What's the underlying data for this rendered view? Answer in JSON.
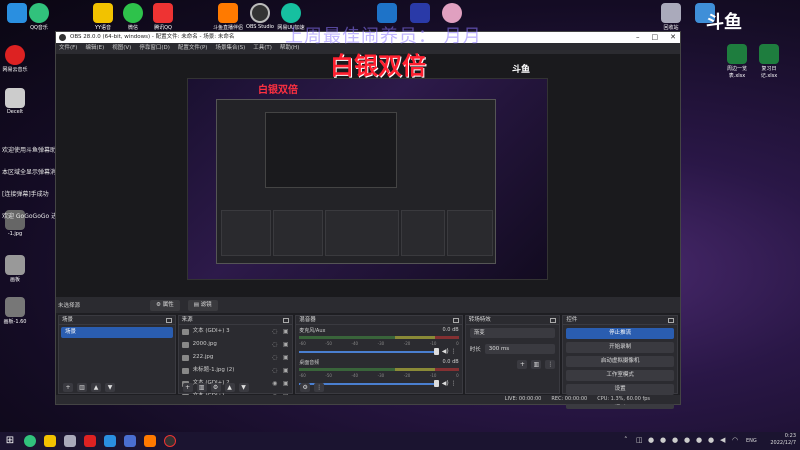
{
  "desktop": {
    "icons_top": [
      {
        "label": "QQ",
        "color": "#2a8fe0"
      },
      {
        "label": "QQ音乐",
        "color": "#31c27c"
      },
      {
        "label": "YY语音",
        "color": "#f2c200"
      },
      {
        "label": "微信",
        "color": "#2ec24b"
      },
      {
        "label": "腾讯QQ",
        "color": "#e33"
      },
      {
        "label": "斗鱼直播伴侣",
        "color": "#ff7a00"
      },
      {
        "label": "OBS Studio",
        "color": "#333"
      },
      {
        "label": "网易UU加速器",
        "color": "#16c0a0"
      },
      {
        "label": "",
        "color": "#1e73c8"
      },
      {
        "label": "",
        "color": "#2a3aa8"
      },
      {
        "label": "",
        "color": "#e0a0c0"
      },
      {
        "label": "回收站",
        "color": "#aab"
      },
      {
        "label": "",
        "color": "#3f8fd8"
      }
    ],
    "icons_left": [
      {
        "label": "网易云音乐",
        "color": "#d22"
      },
      {
        "label": "Decelt",
        "color": "#ccc"
      },
      {
        "label": "",
        "color": "#4a4"
      },
      {
        "label": "-1.jpg",
        "color": "#666"
      },
      {
        "label": "画板",
        "color": "#999"
      },
      {
        "label": "画板-1.60",
        "color": "#777"
      }
    ],
    "icons_right": [
      {
        "label": "周边一览表.xlsx",
        "color": "#1e7d3e"
      },
      {
        "label": "复习日记.xlsx",
        "color": "#1e7d3e"
      }
    ],
    "overlay_title": "上周最佳闹养员： 月月",
    "overlay_main": "白银双倍",
    "douyu_logo": "斗鱼",
    "chat": [
      "欢迎使用斗鱼弹幕助手",
      "本区域全显示弹幕消息和礼物消息",
      "[连接弹幕]手成功",
      "欢迎 GoGoGoGo 进入直播间"
    ]
  },
  "obs": {
    "title": "OBS 28.0.0 (64-bit, windows) - 配置文件: 未命名 - 场景: 未命名",
    "menu": [
      "文件(F)",
      "编辑(E)",
      "视图(V)",
      "停靠窗口(D)",
      "配置文件(P)",
      "场景集合(S)",
      "工具(T)",
      "帮助(H)"
    ],
    "nested_label": "白银双倍",
    "status_strip": {
      "no_source": "未选择源",
      "properties": "属性",
      "filters": "滤镜"
    },
    "scenes": {
      "title": "场景",
      "items": [
        "场景"
      ]
    },
    "sources": {
      "title": "来源",
      "items": [
        {
          "label": "文本 (GDI+) 3",
          "visible": false
        },
        {
          "label": "2000.jpg",
          "visible": false
        },
        {
          "label": "222.jpg",
          "visible": false
        },
        {
          "label": "未标题-1.jpg (2)",
          "visible": false
        },
        {
          "label": "文本 (GDI+) 2",
          "visible": true
        },
        {
          "label": "文本 (GDI+)",
          "visible": true
        }
      ]
    },
    "mixer": {
      "title": "混音器",
      "channels": [
        {
          "name": "麦克风/Aux",
          "db": "0.0 dB",
          "level": 0.9
        },
        {
          "name": "桌面音频",
          "db": "0.0 dB",
          "level": 0.9
        }
      ],
      "scale": [
        "-60",
        "-55",
        "-50",
        "-45",
        "-40",
        "-35",
        "-30",
        "-25",
        "-20",
        "-15",
        "-10",
        "-5",
        "0"
      ]
    },
    "transitions": {
      "title": "转场特效",
      "type": "渐变",
      "duration_label": "时长",
      "duration": "300 ms"
    },
    "controls": {
      "title": "控件",
      "buttons": [
        "停止推流",
        "开始录制",
        "启动虚拟摄像机",
        "工作室模式",
        "设置",
        "退出"
      ]
    },
    "statusbar": {
      "live": "LIVE: 00:00:00",
      "rec": "REC: 00:00:00",
      "cpu": "CPU: 1.3%, 60.00 fps"
    }
  },
  "taskbar": {
    "time": "0:23",
    "date": "2022/12/7",
    "lang": "ENG"
  }
}
